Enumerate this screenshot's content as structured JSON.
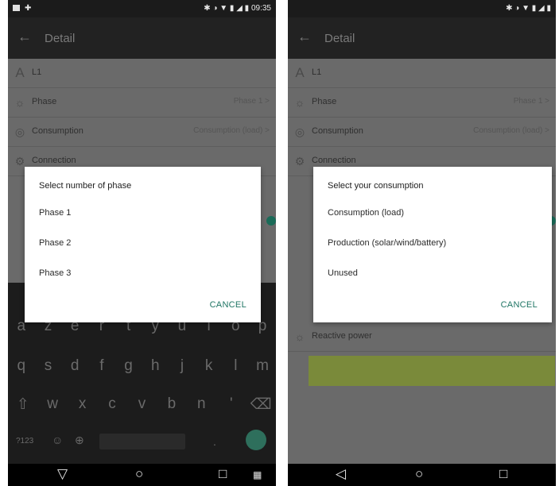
{
  "left": {
    "status_bar": {
      "time": "09:35"
    },
    "app_bar": {
      "title": "Detail"
    },
    "rows": [
      {
        "label": "L1",
        "value": ""
      },
      {
        "label": "Phase",
        "value": "Phase 1 >"
      },
      {
        "label": "Consumption",
        "value": "Consumption (load) >"
      },
      {
        "label": "Connection",
        "value": ""
      }
    ],
    "dialog": {
      "title": "Select number of phase",
      "options": [
        "Phase 1",
        "Phase 2",
        "Phase 3"
      ],
      "cancel": "CANCEL"
    },
    "keyboard": {
      "row1": [
        "a",
        "z",
        "e",
        "r",
        "t",
        "y",
        "u",
        "i",
        "o",
        "p"
      ],
      "row2": [
        "q",
        "s",
        "d",
        "f",
        "g",
        "h",
        "j",
        "k",
        "l",
        "m"
      ],
      "row3": [
        "⇧",
        "w",
        "x",
        "c",
        "v",
        "b",
        "n",
        "'",
        "⌫"
      ],
      "symbols_key": "?123"
    }
  },
  "right": {
    "app_bar": {
      "title": "Detail"
    },
    "rows": [
      {
        "label": "L1",
        "value": ""
      },
      {
        "label": "Phase",
        "value": "Phase 1 >"
      },
      {
        "label": "Consumption",
        "value": "Consumption (load) >"
      },
      {
        "label": "Connection",
        "value": ""
      }
    ],
    "reactive_label": "Reactive power",
    "dialog": {
      "title": "Select your consumption",
      "options": [
        "Consumption (load)",
        "Production (solar/wind/battery)",
        "Unused"
      ],
      "cancel": "CANCEL"
    }
  },
  "colors": {
    "accent": "#1f7564",
    "save_button": "#7a8a3a"
  }
}
